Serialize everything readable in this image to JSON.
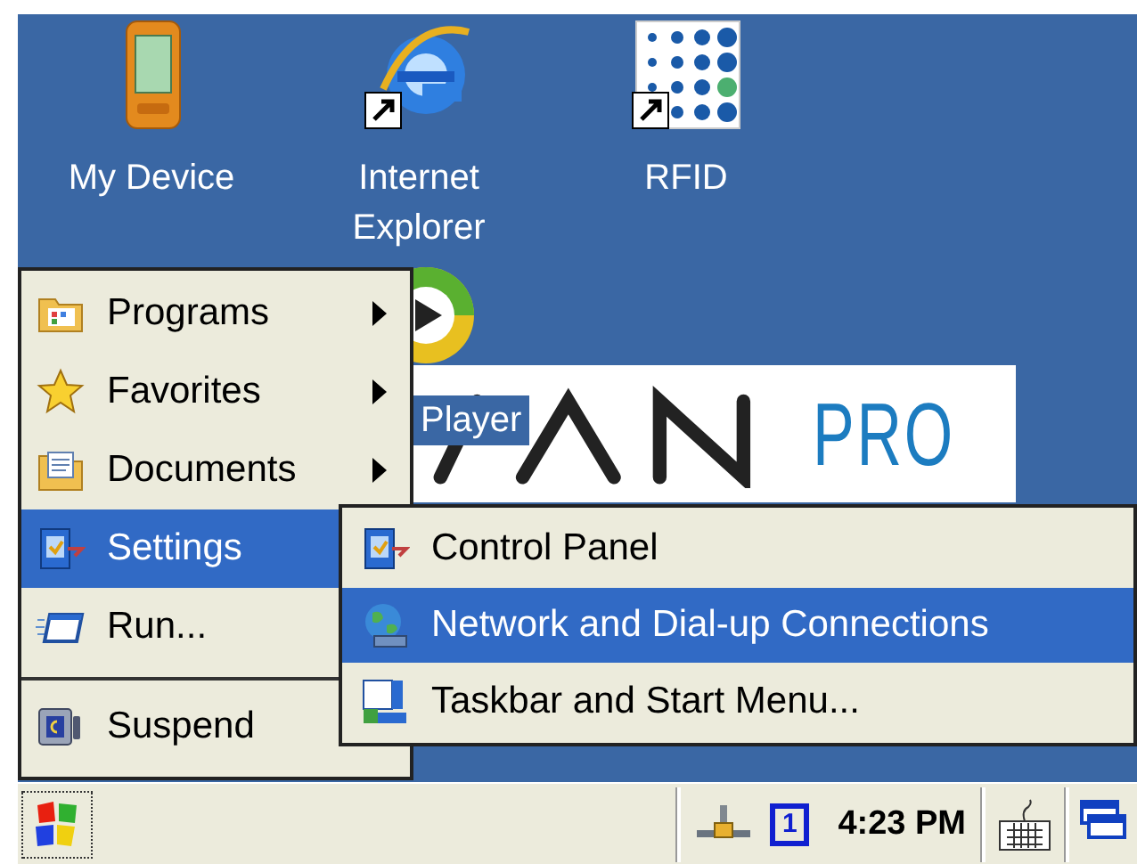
{
  "desktop_icons": [
    {
      "label": "My Device",
      "kind": "device",
      "shortcut": false
    },
    {
      "label": "Internet Explorer",
      "kind": "browser",
      "shortcut": true
    },
    {
      "label": "RFID",
      "kind": "dots",
      "shortcut": true
    }
  ],
  "partial_icon_label": "Player",
  "wallpaper_logo": {
    "text": "PRO"
  },
  "start_menu": {
    "items": [
      {
        "label": "Programs",
        "kind": "programs",
        "arrow": true,
        "selected": false
      },
      {
        "label": "Favorites",
        "kind": "star",
        "arrow": true,
        "selected": false
      },
      {
        "label": "Documents",
        "kind": "documents",
        "arrow": true,
        "selected": false
      },
      {
        "label": "Settings",
        "kind": "settings",
        "arrow": false,
        "selected": true
      },
      {
        "label": "Run...",
        "kind": "run",
        "arrow": false,
        "selected": false
      },
      {
        "kind": "separator"
      },
      {
        "label": "Suspend",
        "kind": "suspend",
        "arrow": false,
        "selected": false
      }
    ]
  },
  "submenu": {
    "items": [
      {
        "label": "Control Panel",
        "kind": "settings",
        "selected": false
      },
      {
        "label": "Network and Dial-up Connections",
        "kind": "globe",
        "selected": true
      },
      {
        "label": "Taskbar and Start Menu...",
        "kind": "taskbar",
        "selected": false
      }
    ]
  },
  "taskbar": {
    "input_indicator": "1",
    "clock": "4:23 PM"
  }
}
